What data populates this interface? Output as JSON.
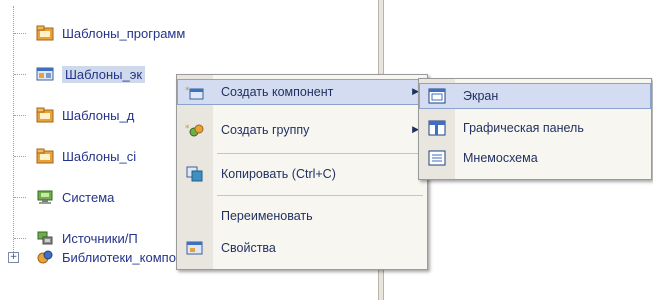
{
  "tree": {
    "items": [
      {
        "label": "Шаблоны_программ",
        "icon": "folder-template-icon"
      },
      {
        "label": "Шаблоны_эк",
        "icon": "screen-template-icon",
        "selected": true
      },
      {
        "label": "Шаблоны_д",
        "icon": "folder-template-icon"
      },
      {
        "label": "Шаблоны_сі",
        "icon": "folder-template-icon"
      },
      {
        "label": "Система",
        "icon": "system-icon"
      },
      {
        "label": "Источники/П",
        "icon": "sources-icon"
      },
      {
        "label": "Библиотеки_компонентов",
        "icon": "library-icon"
      }
    ]
  },
  "context_menu": {
    "items": [
      {
        "label": "Создать компонент",
        "icon": "create-component-icon",
        "submenu": true,
        "highlighted": true
      },
      {
        "label": "Создать группу",
        "icon": "create-group-icon",
        "submenu": true
      },
      {
        "label": "Копировать (Ctrl+C)",
        "icon": "copy-icon"
      },
      {
        "label": "Переименовать",
        "icon": ""
      },
      {
        "label": "Свойства",
        "icon": "properties-icon"
      }
    ]
  },
  "submenu": {
    "items": [
      {
        "label": "Экран",
        "icon": "screen-icon",
        "highlighted": true
      },
      {
        "label": "Графическая панель",
        "icon": "graphic-panel-icon"
      },
      {
        "label": "Мнемосхема",
        "icon": "mnemonic-scheme-icon"
      }
    ]
  },
  "colors": {
    "highlight": "#d3dcf0",
    "selection": "#cfd9ec",
    "menu_bg": "#f7f6f1",
    "text": "#24348a"
  }
}
